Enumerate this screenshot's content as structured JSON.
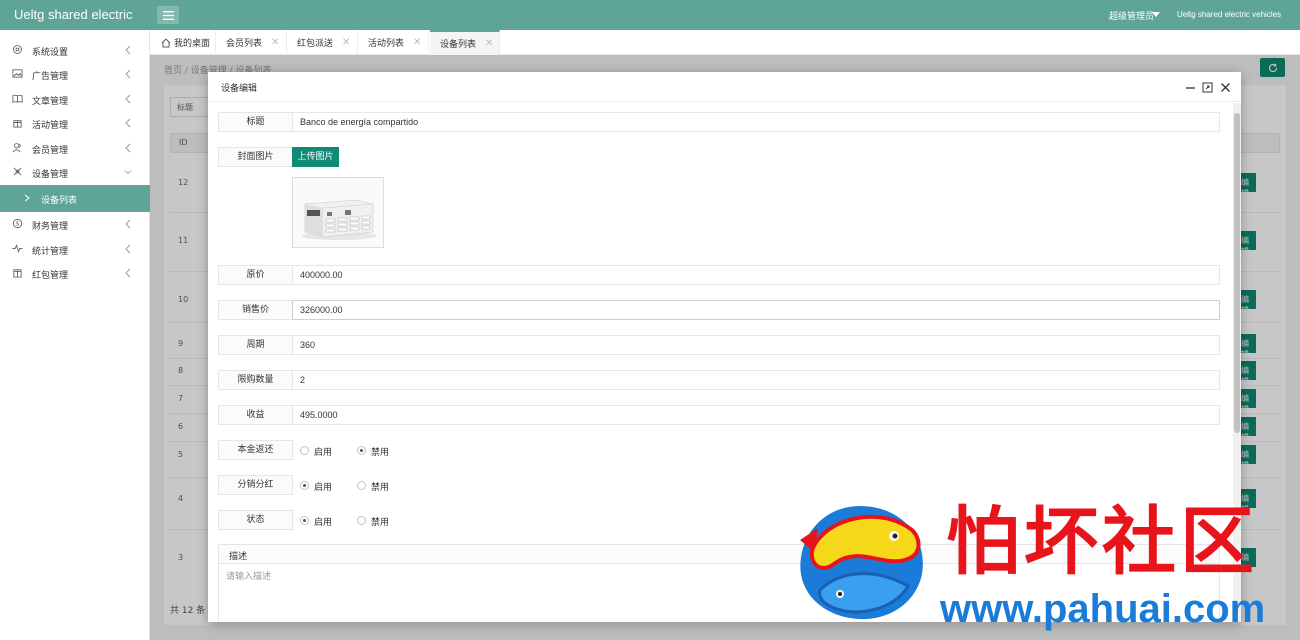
{
  "header": {
    "brand": "Ueltg shared electric",
    "admin": "超级管理员",
    "company": "Ueltg shared electric vehicles"
  },
  "sidebar": {
    "items": [
      {
        "label": "系统设置",
        "icon": "gear-icon"
      },
      {
        "label": "广告管理",
        "icon": "image-icon"
      },
      {
        "label": "文章管理",
        "icon": "book-icon"
      },
      {
        "label": "活动管理",
        "icon": "gift-icon"
      },
      {
        "label": "会员管理",
        "icon": "users-icon"
      },
      {
        "label": "设备管理",
        "icon": "device-icon"
      },
      {
        "label": "财务管理",
        "icon": "dollar-icon"
      },
      {
        "label": "统计管理",
        "icon": "pulse-icon"
      },
      {
        "label": "红包管理",
        "icon": "redpacket-icon"
      }
    ],
    "sub_active": "设备列表"
  },
  "tabs": [
    {
      "label": "我的桌面"
    },
    {
      "label": "会员列表"
    },
    {
      "label": "红包派送"
    },
    {
      "label": "活动列表"
    },
    {
      "label": "设备列表"
    }
  ],
  "breadcrumb": "首页  /  设备管理  /  设备列表",
  "background": {
    "filter_placeholder": "标题",
    "id_header": "ID",
    "ids": [
      "12",
      "11",
      "10",
      "9",
      "8",
      "7",
      "6",
      "5",
      "4",
      "3"
    ],
    "edit_label": "编辑",
    "total": "共 12 条"
  },
  "modal": {
    "title": "设备编辑",
    "fields": {
      "title_label": "标题",
      "title_value": "Banco de energía compartido",
      "cover_label": "封面图片",
      "upload_label": "上传图片",
      "original_price_label": "原价",
      "original_price_value": "400000.00",
      "sale_price_label": "销售价",
      "sale_price_value": "326000.00",
      "period_label": "周期",
      "period_value": "360",
      "limit_label": "限购数量",
      "limit_value": "2",
      "income_label": "收益",
      "income_value": "495.0000",
      "refund_label": "本金返还",
      "dividend_label": "分销分红",
      "status_label": "状态",
      "enable_label": "启用",
      "disable_label": "禁用",
      "desc_label": "描述",
      "desc_placeholder": "请输入描述"
    },
    "radios": {
      "refund": "禁用",
      "dividend": "启用",
      "status": "启用"
    }
  },
  "watermark": {
    "text": "怕坏社区",
    "url": "www.pahuai.com"
  },
  "colors": {
    "header": "#5fa597",
    "primary_button": "#0f8a74",
    "watermark_red": "#e8141c",
    "watermark_blue": "#1a7cd8"
  }
}
